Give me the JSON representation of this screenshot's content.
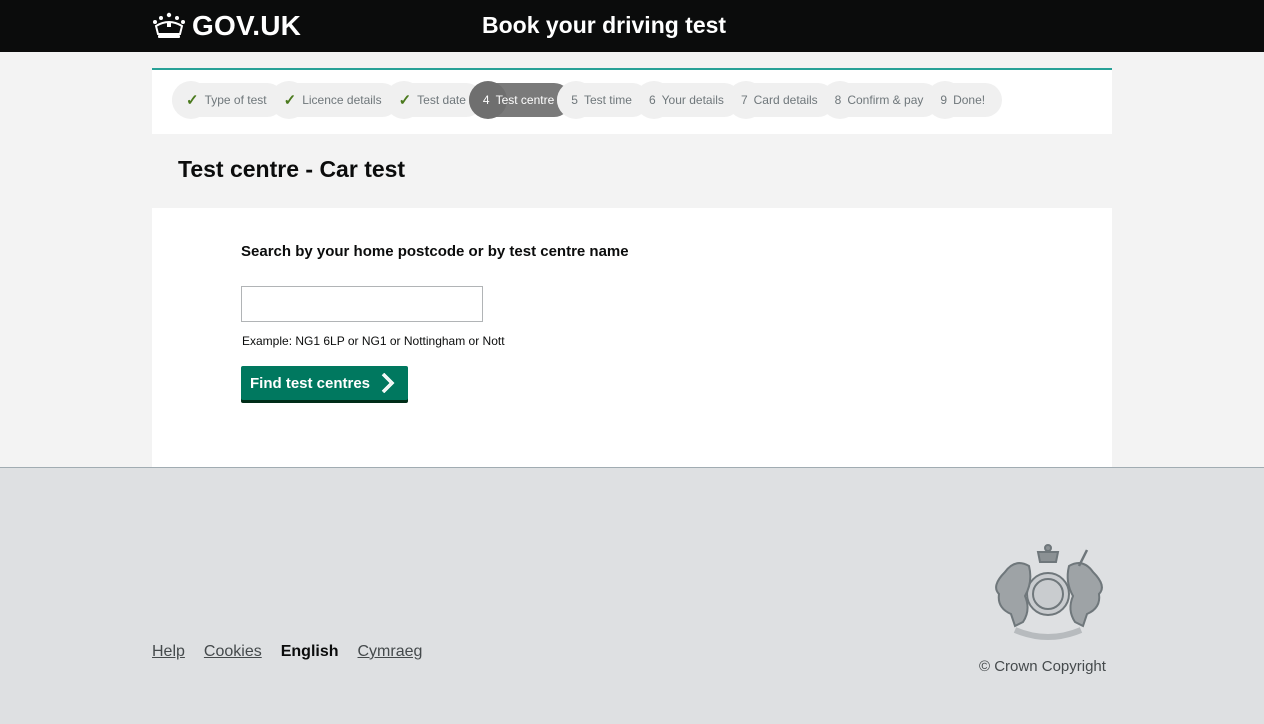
{
  "header": {
    "logo_text": "GOV.UK",
    "service_name": "Book your driving test"
  },
  "steps": [
    {
      "marker": "✓",
      "label": "Type of test",
      "state": "done"
    },
    {
      "marker": "✓",
      "label": "Licence details",
      "state": "done"
    },
    {
      "marker": "✓",
      "label": "Test date",
      "state": "done"
    },
    {
      "marker": "4",
      "label": "Test centre",
      "state": "active"
    },
    {
      "marker": "5",
      "label": "Test time",
      "state": "todo"
    },
    {
      "marker": "6",
      "label": "Your details",
      "state": "todo"
    },
    {
      "marker": "7",
      "label": "Card details",
      "state": "todo"
    },
    {
      "marker": "8",
      "label": "Confirm & pay",
      "state": "todo"
    },
    {
      "marker": "9",
      "label": "Done!",
      "state": "todo"
    }
  ],
  "main": {
    "title": "Test centre - Car test",
    "search_label": "Search by your home postcode or by test centre name",
    "search_value": "",
    "hint": "Example: NG1 6LP or NG1 or Nottingham or Nott",
    "button_label": "Find test centres"
  },
  "footer": {
    "links": {
      "help": "Help",
      "cookies": "Cookies",
      "english": "English",
      "cymraeg": "Cymraeg"
    },
    "copyright": "© Crown Copyright"
  },
  "colors": {
    "header_bg": "#0b0c0c",
    "accent_border": "#28a197",
    "button_bg": "#00785f",
    "check_green": "#4b7a1e",
    "footer_bg": "#dee0e2"
  },
  "icons": {
    "logo": "crown-icon",
    "done_step": "check-icon",
    "button": "chevron-right-icon",
    "footer": "royal-coat-of-arms-icon"
  }
}
